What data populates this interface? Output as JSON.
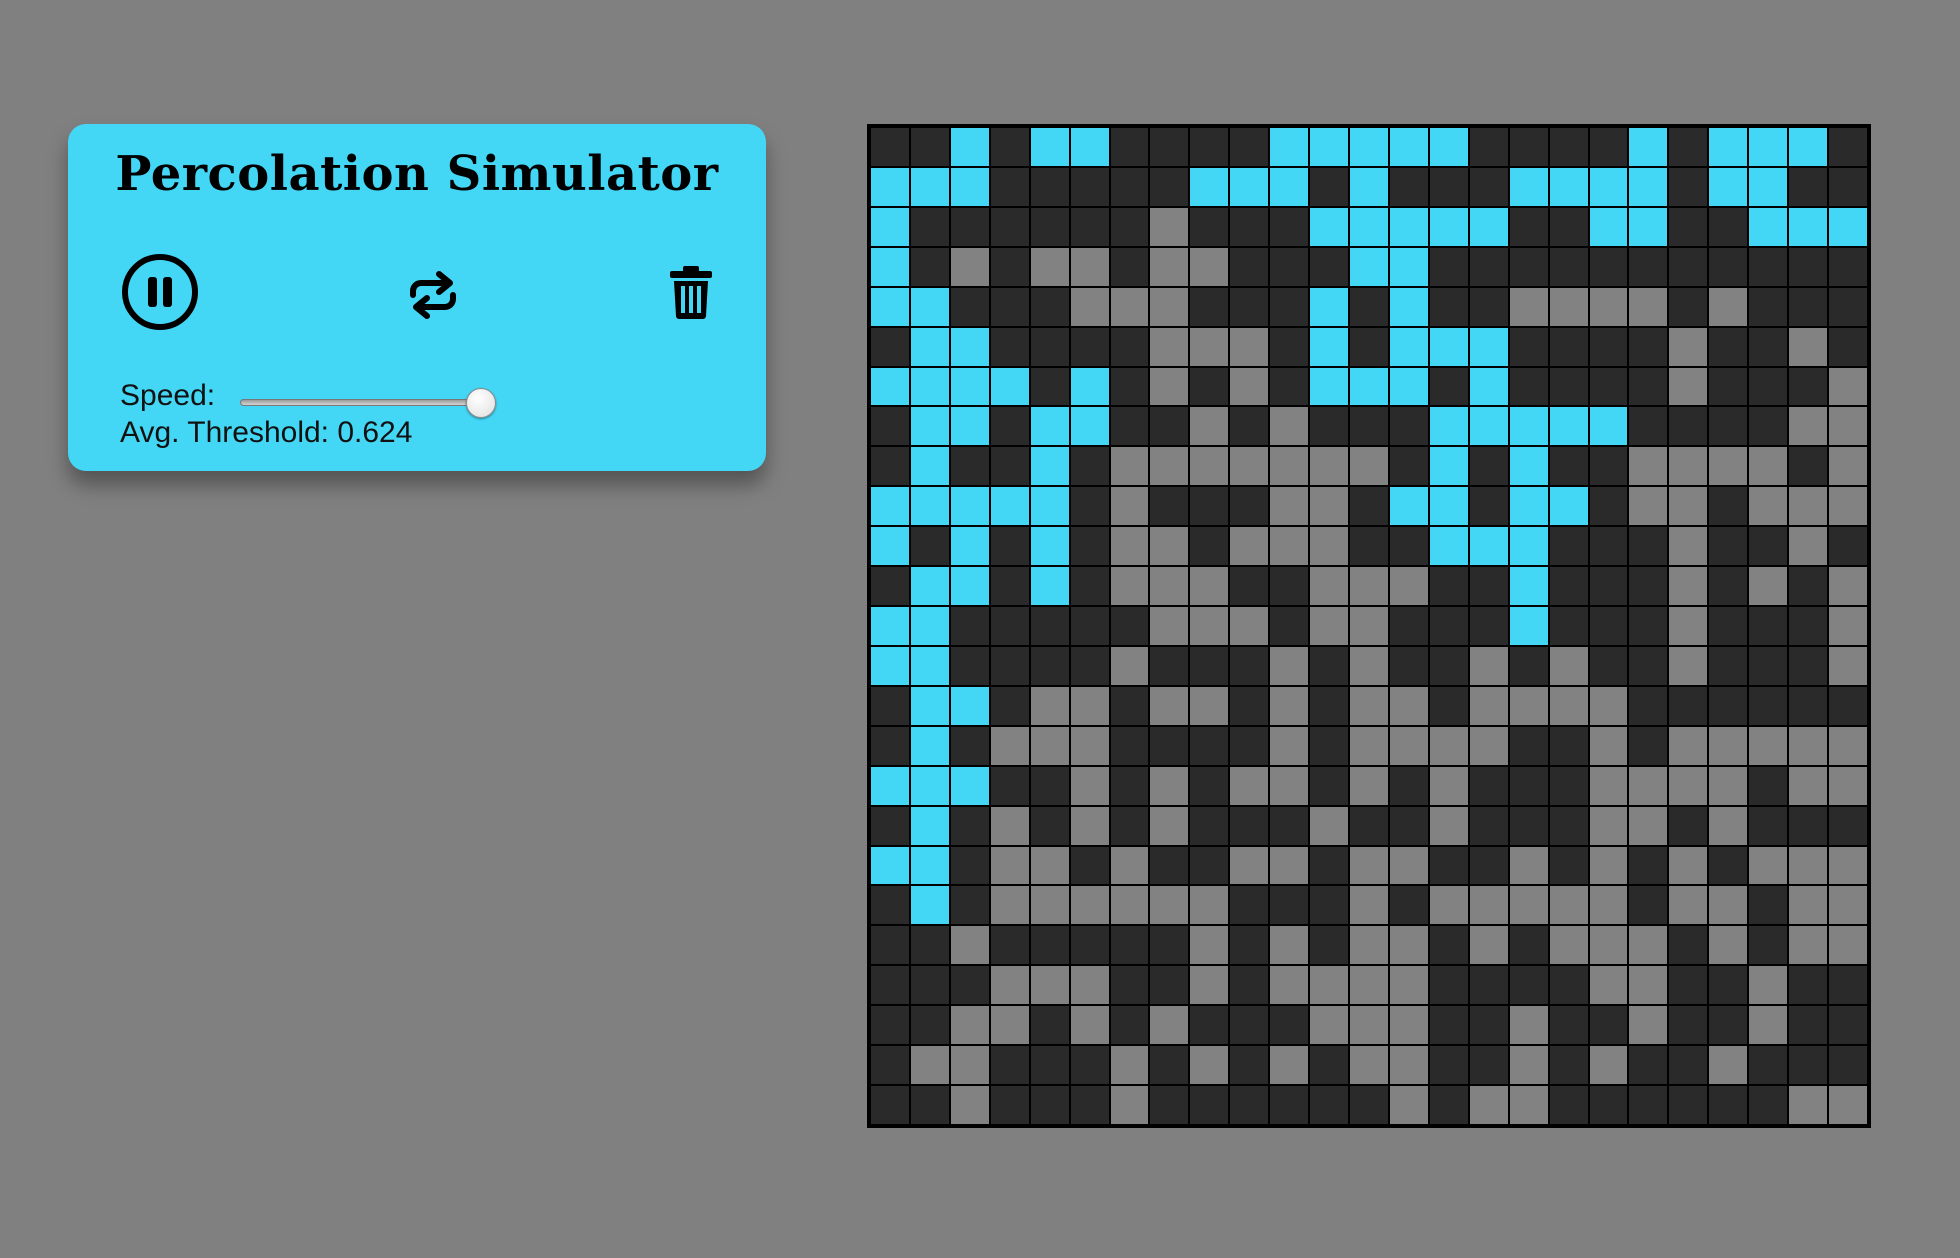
{
  "title": "Percolation Simulator",
  "controls": {
    "pause_icon": "pause-circle-icon",
    "restart_icon": "repeat-icon",
    "clear_icon": "trash-icon"
  },
  "speed": {
    "label": "Speed:",
    "value_fraction": 1.0
  },
  "threshold_text": "Avg. Threshold: 0.624",
  "colors": {
    "panel": "#43d7f5",
    "background": "#808080",
    "blocked": "#2a2a2a",
    "open": "#828282",
    "filled": "#43d7f5"
  },
  "grid": {
    "size": 25,
    "legend": "B = blocked, O = open, F = filled",
    "rows": [
      "BBFBFFBBBBFFFFFBBBBFBFFFB",
      "FFFBBBBBFFFBFBBBFFFFBFFBB",
      "FBBBBBBOBBBFFFFFBBFFBBFFF",
      "FBOBOOBOOBBBFFBBBBBBBBBBB",
      "FFBBBOOOBBBFBFBBOOOOBOBBB",
      "BFFBBBBOOOBFBFFFBBBBOBBOB",
      "FFFFBFBOBOBFFFBFBBBBOBBBO",
      "BFFBFFBBOBOBBBFFFFFBBBBOO",
      "BFBBFBOOOOOOOBFBFBBOOOOBO",
      "FFFFFBOBBBOOBFFBFFBOOBOOO",
      "FBFBFBOOBOOOBBFFFBBBOBBOB",
      "BFFBFBOOOBBOOOBBFBBBOBOBO",
      "FFBBBBBOOOBOOBBBFBBBOBBBO",
      "FFBBBBOBBBOBOBBOBOBBOBBBO",
      "BFFBOOBOOBOBOOBOOOOBBBBBB",
      "BFBOOOBBBBOBOOOOBBOBOOOOO",
      "FFFBBOBOBOOBOBOBBBOOOOBOO",
      "BFBOBOBOBBBOBBOBBBOOBOBBB",
      "FFBOOBOBBOOBOOBBOBOBOBOOO",
      "BFBOOOOOOBBBOBOOOOOBOOBOO",
      "BBOBBBBBOBOBOOBOBOOOBOBOO",
      "BBBOOOBBOBOOOOBBBBOOBBOBB",
      "BBOOBOBOBBBOOOBBOBBOBBOBB",
      "BOOBBBOBOBOBOOBBOBOBBOBBB",
      "BBOBBBOBBBBBBOBOOBBBBBBOO"
    ]
  }
}
